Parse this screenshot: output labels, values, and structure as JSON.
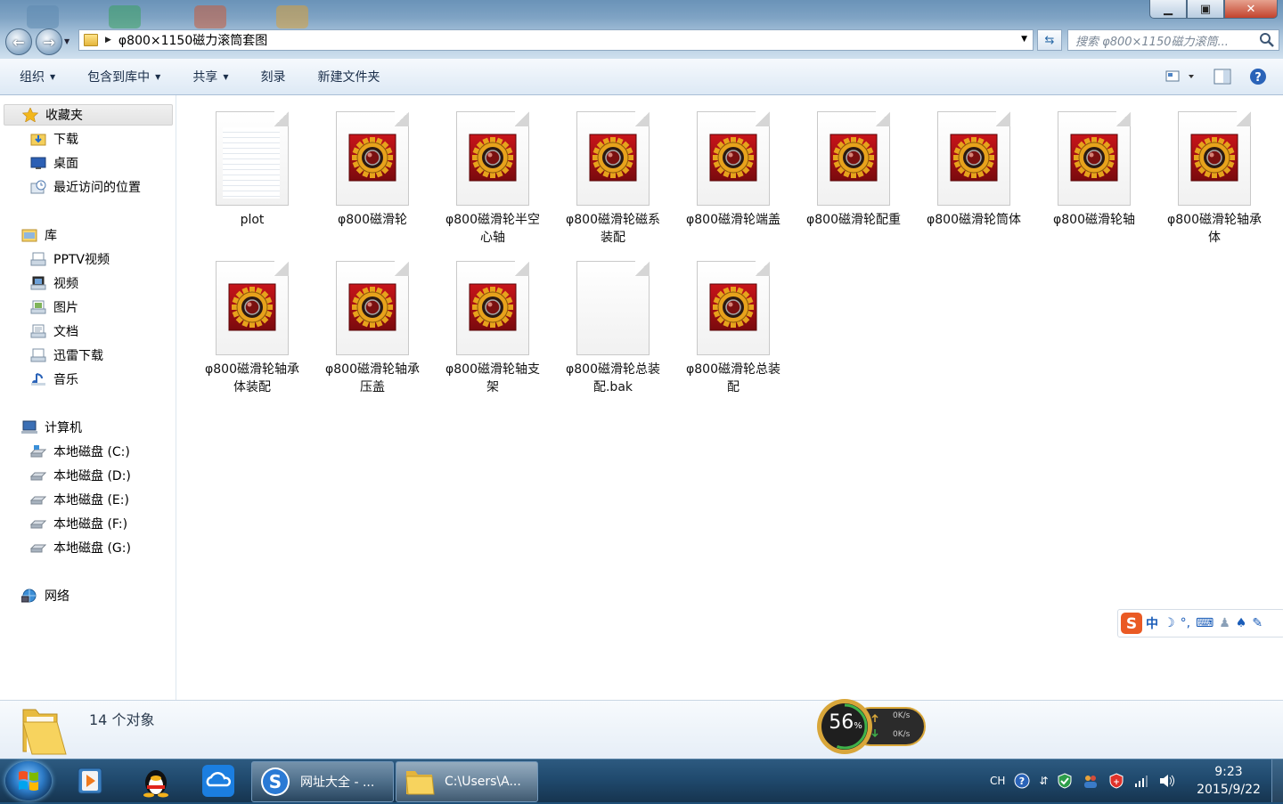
{
  "window": {
    "address_path": "φ800×1150磁力滚筒套图",
    "search_placeholder": "搜索 φ800×1150磁力滚筒...",
    "controls": {
      "minimize": "▁",
      "maximize": "▣",
      "close": "✕"
    }
  },
  "toolbar": {
    "organize": "组织",
    "include_in_library": "包含到库中",
    "share": "共享",
    "burn": "刻录",
    "new_folder": "新建文件夹"
  },
  "nav": {
    "favorites": {
      "label": "收藏夹",
      "items": [
        "下载",
        "桌面",
        "最近访问的位置"
      ]
    },
    "libraries": {
      "label": "库",
      "items": [
        "PPTV视频",
        "视频",
        "图片",
        "文档",
        "迅雷下载",
        "音乐"
      ]
    },
    "computer": {
      "label": "计算机",
      "items": [
        "本地磁盘 (C:)",
        "本地磁盘 (D:)",
        "本地磁盘 (E:)",
        "本地磁盘 (F:)",
        "本地磁盘 (G:)"
      ]
    },
    "network": {
      "label": "网络"
    }
  },
  "files": [
    {
      "name": "plot",
      "type": "text"
    },
    {
      "name": "φ800磁滑轮",
      "type": "solidworks"
    },
    {
      "name": "φ800磁滑轮半空心轴",
      "type": "solidworks"
    },
    {
      "name": "φ800磁滑轮磁系装配",
      "type": "solidworks"
    },
    {
      "name": "φ800磁滑轮端盖",
      "type": "solidworks"
    },
    {
      "name": "φ800磁滑轮配重",
      "type": "solidworks"
    },
    {
      "name": "φ800磁滑轮筒体",
      "type": "solidworks"
    },
    {
      "name": "φ800磁滑轮轴",
      "type": "solidworks"
    },
    {
      "name": "φ800磁滑轮轴承体",
      "type": "solidworks"
    },
    {
      "name": "φ800磁滑轮轴承体装配",
      "type": "solidworks"
    },
    {
      "name": "φ800磁滑轮轴承压盖",
      "type": "solidworks"
    },
    {
      "name": "φ800磁滑轮轴支架",
      "type": "solidworks"
    },
    {
      "name": "φ800磁滑轮总装配.bak",
      "type": "blank"
    },
    {
      "name": "φ800磁滑轮总装配",
      "type": "solidworks"
    }
  ],
  "details": {
    "count": "14 个对象"
  },
  "gauge": {
    "percent": "56",
    "unit": "%",
    "up": "0K/s",
    "down": "0K/s"
  },
  "ime": {
    "lang": "中"
  },
  "taskbar": {
    "windows": [
      {
        "label": "网址大全 - ..."
      },
      {
        "label": "C:\\Users\\A..."
      }
    ],
    "tray_lang": "CH",
    "time": "9:23",
    "date": "2015/9/22"
  },
  "colors": {
    "accent": "#2b6cb0",
    "badge_red": "#c8141a",
    "gear_gold": "#e7a21c"
  }
}
